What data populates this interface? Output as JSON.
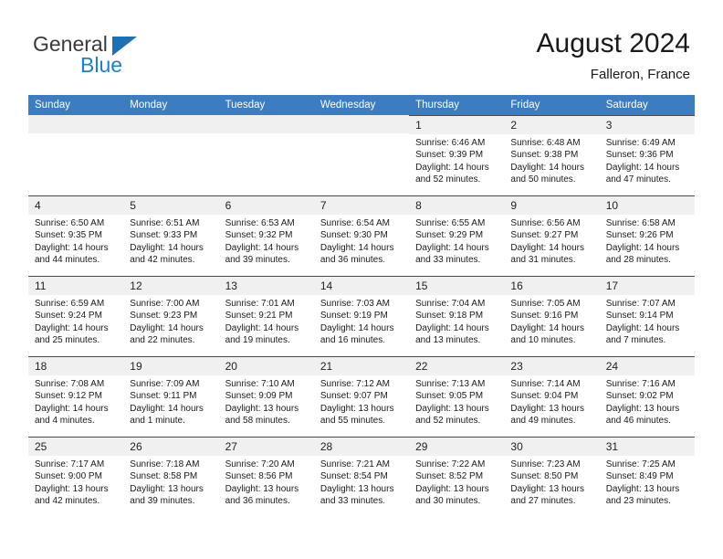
{
  "brand": {
    "name_top": "General",
    "name_bottom": "Blue",
    "flag_icon": "triangle-flag-icon",
    "color_top": "#3a3a3a",
    "color_bottom": "#1b7fd4"
  },
  "header": {
    "title": "August 2024",
    "location": "Falleron, France"
  },
  "theme": {
    "header_bg": "#3b7dc0",
    "header_text": "#ffffff",
    "daynum_bg": "#f0f0f0",
    "cell_border": "#4a4a4a",
    "page_bg": "#ffffff"
  },
  "weekday_headers": [
    "Sunday",
    "Monday",
    "Tuesday",
    "Wednesday",
    "Thursday",
    "Friday",
    "Saturday"
  ],
  "labels": {
    "sunrise": "Sunrise:",
    "sunset": "Sunset:",
    "daylight": "Daylight:"
  },
  "weeks": [
    [
      {
        "day": "",
        "empty": true,
        "sunrise": "",
        "sunset": "",
        "daylight_1": "",
        "daylight_2": ""
      },
      {
        "day": "",
        "empty": true,
        "sunrise": "",
        "sunset": "",
        "daylight_1": "",
        "daylight_2": ""
      },
      {
        "day": "",
        "empty": true,
        "sunrise": "",
        "sunset": "",
        "daylight_1": "",
        "daylight_2": ""
      },
      {
        "day": "",
        "empty": true,
        "sunrise": "",
        "sunset": "",
        "daylight_1": "",
        "daylight_2": ""
      },
      {
        "day": "1",
        "empty": false,
        "sunrise": "Sunrise: 6:46 AM",
        "sunset": "Sunset: 9:39 PM",
        "daylight_1": "Daylight: 14 hours",
        "daylight_2": "and 52 minutes."
      },
      {
        "day": "2",
        "empty": false,
        "sunrise": "Sunrise: 6:48 AM",
        "sunset": "Sunset: 9:38 PM",
        "daylight_1": "Daylight: 14 hours",
        "daylight_2": "and 50 minutes."
      },
      {
        "day": "3",
        "empty": false,
        "sunrise": "Sunrise: 6:49 AM",
        "sunset": "Sunset: 9:36 PM",
        "daylight_1": "Daylight: 14 hours",
        "daylight_2": "and 47 minutes."
      }
    ],
    [
      {
        "day": "4",
        "empty": false,
        "sunrise": "Sunrise: 6:50 AM",
        "sunset": "Sunset: 9:35 PM",
        "daylight_1": "Daylight: 14 hours",
        "daylight_2": "and 44 minutes."
      },
      {
        "day": "5",
        "empty": false,
        "sunrise": "Sunrise: 6:51 AM",
        "sunset": "Sunset: 9:33 PM",
        "daylight_1": "Daylight: 14 hours",
        "daylight_2": "and 42 minutes."
      },
      {
        "day": "6",
        "empty": false,
        "sunrise": "Sunrise: 6:53 AM",
        "sunset": "Sunset: 9:32 PM",
        "daylight_1": "Daylight: 14 hours",
        "daylight_2": "and 39 minutes."
      },
      {
        "day": "7",
        "empty": false,
        "sunrise": "Sunrise: 6:54 AM",
        "sunset": "Sunset: 9:30 PM",
        "daylight_1": "Daylight: 14 hours",
        "daylight_2": "and 36 minutes."
      },
      {
        "day": "8",
        "empty": false,
        "sunrise": "Sunrise: 6:55 AM",
        "sunset": "Sunset: 9:29 PM",
        "daylight_1": "Daylight: 14 hours",
        "daylight_2": "and 33 minutes."
      },
      {
        "day": "9",
        "empty": false,
        "sunrise": "Sunrise: 6:56 AM",
        "sunset": "Sunset: 9:27 PM",
        "daylight_1": "Daylight: 14 hours",
        "daylight_2": "and 31 minutes."
      },
      {
        "day": "10",
        "empty": false,
        "sunrise": "Sunrise: 6:58 AM",
        "sunset": "Sunset: 9:26 PM",
        "daylight_1": "Daylight: 14 hours",
        "daylight_2": "and 28 minutes."
      }
    ],
    [
      {
        "day": "11",
        "empty": false,
        "sunrise": "Sunrise: 6:59 AM",
        "sunset": "Sunset: 9:24 PM",
        "daylight_1": "Daylight: 14 hours",
        "daylight_2": "and 25 minutes."
      },
      {
        "day": "12",
        "empty": false,
        "sunrise": "Sunrise: 7:00 AM",
        "sunset": "Sunset: 9:23 PM",
        "daylight_1": "Daylight: 14 hours",
        "daylight_2": "and 22 minutes."
      },
      {
        "day": "13",
        "empty": false,
        "sunrise": "Sunrise: 7:01 AM",
        "sunset": "Sunset: 9:21 PM",
        "daylight_1": "Daylight: 14 hours",
        "daylight_2": "and 19 minutes."
      },
      {
        "day": "14",
        "empty": false,
        "sunrise": "Sunrise: 7:03 AM",
        "sunset": "Sunset: 9:19 PM",
        "daylight_1": "Daylight: 14 hours",
        "daylight_2": "and 16 minutes."
      },
      {
        "day": "15",
        "empty": false,
        "sunrise": "Sunrise: 7:04 AM",
        "sunset": "Sunset: 9:18 PM",
        "daylight_1": "Daylight: 14 hours",
        "daylight_2": "and 13 minutes."
      },
      {
        "day": "16",
        "empty": false,
        "sunrise": "Sunrise: 7:05 AM",
        "sunset": "Sunset: 9:16 PM",
        "daylight_1": "Daylight: 14 hours",
        "daylight_2": "and 10 minutes."
      },
      {
        "day": "17",
        "empty": false,
        "sunrise": "Sunrise: 7:07 AM",
        "sunset": "Sunset: 9:14 PM",
        "daylight_1": "Daylight: 14 hours",
        "daylight_2": "and 7 minutes."
      }
    ],
    [
      {
        "day": "18",
        "empty": false,
        "sunrise": "Sunrise: 7:08 AM",
        "sunset": "Sunset: 9:12 PM",
        "daylight_1": "Daylight: 14 hours",
        "daylight_2": "and 4 minutes."
      },
      {
        "day": "19",
        "empty": false,
        "sunrise": "Sunrise: 7:09 AM",
        "sunset": "Sunset: 9:11 PM",
        "daylight_1": "Daylight: 14 hours",
        "daylight_2": "and 1 minute."
      },
      {
        "day": "20",
        "empty": false,
        "sunrise": "Sunrise: 7:10 AM",
        "sunset": "Sunset: 9:09 PM",
        "daylight_1": "Daylight: 13 hours",
        "daylight_2": "and 58 minutes."
      },
      {
        "day": "21",
        "empty": false,
        "sunrise": "Sunrise: 7:12 AM",
        "sunset": "Sunset: 9:07 PM",
        "daylight_1": "Daylight: 13 hours",
        "daylight_2": "and 55 minutes."
      },
      {
        "day": "22",
        "empty": false,
        "sunrise": "Sunrise: 7:13 AM",
        "sunset": "Sunset: 9:05 PM",
        "daylight_1": "Daylight: 13 hours",
        "daylight_2": "and 52 minutes."
      },
      {
        "day": "23",
        "empty": false,
        "sunrise": "Sunrise: 7:14 AM",
        "sunset": "Sunset: 9:04 PM",
        "daylight_1": "Daylight: 13 hours",
        "daylight_2": "and 49 minutes."
      },
      {
        "day": "24",
        "empty": false,
        "sunrise": "Sunrise: 7:16 AM",
        "sunset": "Sunset: 9:02 PM",
        "daylight_1": "Daylight: 13 hours",
        "daylight_2": "and 46 minutes."
      }
    ],
    [
      {
        "day": "25",
        "empty": false,
        "sunrise": "Sunrise: 7:17 AM",
        "sunset": "Sunset: 9:00 PM",
        "daylight_1": "Daylight: 13 hours",
        "daylight_2": "and 42 minutes."
      },
      {
        "day": "26",
        "empty": false,
        "sunrise": "Sunrise: 7:18 AM",
        "sunset": "Sunset: 8:58 PM",
        "daylight_1": "Daylight: 13 hours",
        "daylight_2": "and 39 minutes."
      },
      {
        "day": "27",
        "empty": false,
        "sunrise": "Sunrise: 7:20 AM",
        "sunset": "Sunset: 8:56 PM",
        "daylight_1": "Daylight: 13 hours",
        "daylight_2": "and 36 minutes."
      },
      {
        "day": "28",
        "empty": false,
        "sunrise": "Sunrise: 7:21 AM",
        "sunset": "Sunset: 8:54 PM",
        "daylight_1": "Daylight: 13 hours",
        "daylight_2": "and 33 minutes."
      },
      {
        "day": "29",
        "empty": false,
        "sunrise": "Sunrise: 7:22 AM",
        "sunset": "Sunset: 8:52 PM",
        "daylight_1": "Daylight: 13 hours",
        "daylight_2": "and 30 minutes."
      },
      {
        "day": "30",
        "empty": false,
        "sunrise": "Sunrise: 7:23 AM",
        "sunset": "Sunset: 8:50 PM",
        "daylight_1": "Daylight: 13 hours",
        "daylight_2": "and 27 minutes."
      },
      {
        "day": "31",
        "empty": false,
        "sunrise": "Sunrise: 7:25 AM",
        "sunset": "Sunset: 8:49 PM",
        "daylight_1": "Daylight: 13 hours",
        "daylight_2": "and 23 minutes."
      }
    ]
  ]
}
